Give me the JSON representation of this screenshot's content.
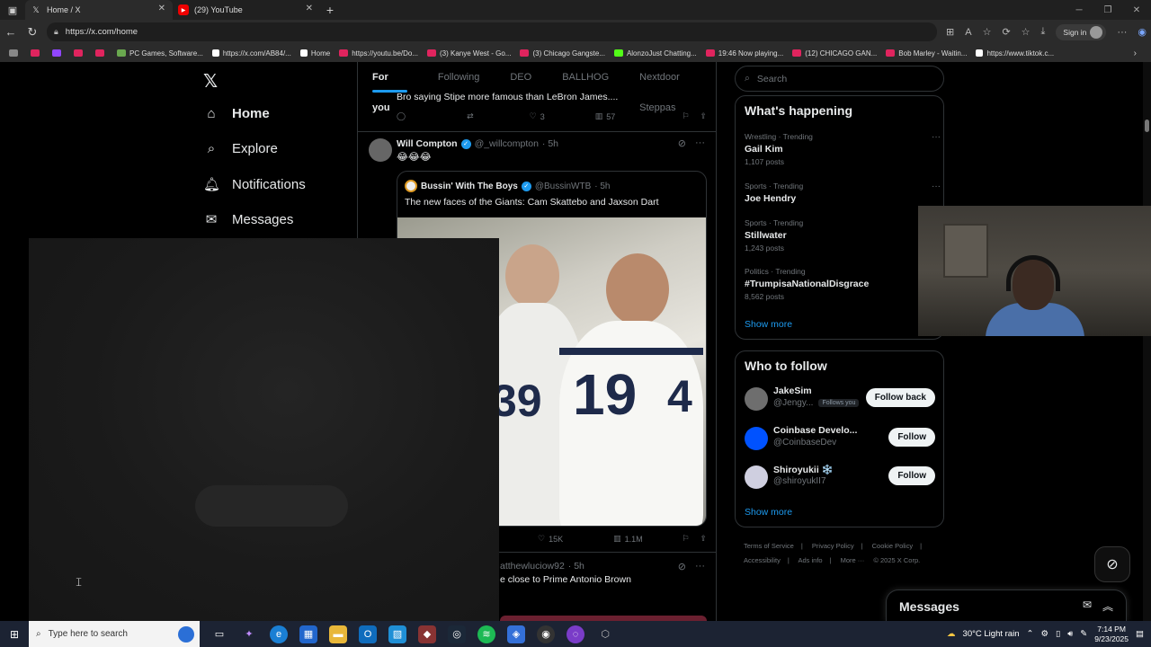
{
  "browser": {
    "tabs": [
      {
        "label": "Home / X",
        "icon": "x-logo-icon"
      },
      {
        "label": "(29) YouTube",
        "icon": "youtube-icon"
      }
    ],
    "url": "https://x.com/home",
    "signin_label": "Sign in",
    "bookmarks": [
      {
        "label": "",
        "color": "#e0245e"
      },
      {
        "label": "",
        "color": "#9146ff"
      },
      {
        "label": "",
        "color": "#e0245e"
      },
      {
        "label": "",
        "color": "#e0245e"
      },
      {
        "label": "PC Games, Software...",
        "color": "#6aa84f"
      },
      {
        "label": "https://x.com/AB84/...",
        "color": "#ffffff"
      },
      {
        "label": "Home",
        "color": "#ffffff"
      },
      {
        "label": "https://youtu.be/Do...",
        "color": "#e0245e"
      },
      {
        "label": "(3) Kanye West - Go...",
        "color": "#e0245e"
      },
      {
        "label": "(3) Chicago Gangste...",
        "color": "#e0245e"
      },
      {
        "label": "AlonzoJust Chatting...",
        "color": "#53fc18"
      },
      {
        "label": "19:46 Now playing...",
        "color": "#e0245e"
      },
      {
        "label": "(12) CHICAGO GAN...",
        "color": "#e0245e"
      },
      {
        "label": "Bob Marley - Waitin...",
        "color": "#e0245e"
      },
      {
        "label": "https://www.tiktok.c...",
        "color": "#ffffff"
      }
    ]
  },
  "sidebar": {
    "items": [
      {
        "label": "Home",
        "icon": "home-icon"
      },
      {
        "label": "Explore",
        "icon": "search-icon"
      },
      {
        "label": "Notifications",
        "icon": "bell-icon"
      },
      {
        "label": "Messages",
        "icon": "mail-icon"
      }
    ]
  },
  "feed": {
    "tabs": [
      "For you",
      "Following",
      "DEO",
      "BALLHOG",
      "Nextdoor Steppas"
    ],
    "prev_post": {
      "text": "Bro saying Stipe more famous than LeBron James....",
      "likes": "3",
      "views": "57"
    },
    "post": {
      "name": "Will Compton",
      "handle": "@_willcompton",
      "time": "· 5h",
      "text": "😂😂😂",
      "quote": {
        "name": "Bussin' With The Boys",
        "handle": "@BussinWTB",
        "time": "· 5h",
        "text": "The new faces of the Giants: Cam Skattebo and Jaxson Dart"
      },
      "likes": "15K",
      "views": "1.1M"
    },
    "next_post": {
      "handle": "atthewluciow92",
      "time": "· 5h",
      "text": "e close to Prime Antonio Brown"
    }
  },
  "right": {
    "search_placeholder": "Search",
    "happening_title": "What's happening",
    "trends": [
      {
        "category": "Wrestling · Trending",
        "name": "Gail Kim",
        "posts": "1,107 posts"
      },
      {
        "category": "Sports · Trending",
        "name": "Joe Hendry",
        "posts": ""
      },
      {
        "category": "Sports · Trending",
        "name": "Stillwater",
        "posts": "1,243 posts"
      },
      {
        "category": "Politics · Trending",
        "name": "#TrumpisaNationalDisgrace",
        "posts": "8,562 posts"
      }
    ],
    "show_more": "Show more",
    "who_to_follow_title": "Who to follow",
    "follow": [
      {
        "name": "JakeSim",
        "handle": "@Jengy...",
        "badge": "Follows you",
        "button": "Follow back"
      },
      {
        "name": "Coinbase Develo...",
        "handle": "@CoinbaseDev",
        "badge": "",
        "button": "Follow"
      },
      {
        "name": "Shiroyukii ❄️",
        "handle": "@shiroyukII7",
        "badge": "",
        "button": "Follow"
      }
    ],
    "footer": [
      "Terms of Service",
      "|",
      "Privacy Policy",
      "|",
      "Cookie Policy",
      "|",
      "Accessibility",
      "|",
      "Ads info",
      "|",
      "More ···",
      "© 2025 X Corp."
    ]
  },
  "messages": {
    "title": "Messages"
  },
  "taskbar": {
    "search_placeholder": "Type here to search",
    "weather": "30°C  Light rain",
    "time": "7:14 PM",
    "date": "9/23/2025"
  }
}
